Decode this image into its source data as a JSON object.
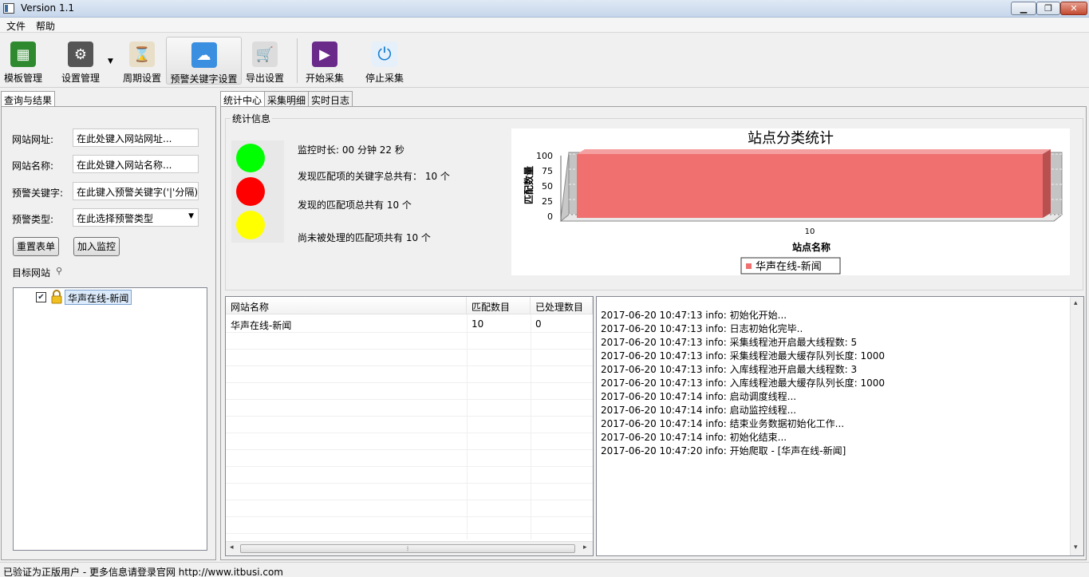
{
  "window": {
    "title": "Version 1.1"
  },
  "menu": {
    "items": [
      "文件",
      "帮助"
    ]
  },
  "toolbar": {
    "buttons": [
      {
        "label": "模板管理",
        "icon": "circuit-board-icon",
        "color": "#2f8a2f"
      },
      {
        "label": "设置管理",
        "icon": "gear-icon",
        "color": "#555555"
      },
      {
        "label": "周期设置",
        "icon": "hourglass-icon",
        "color": "#c8a050"
      },
      {
        "label": "预警关键字设置",
        "icon": "weather-alert-icon",
        "color": "#3a8fe0"
      },
      {
        "label": "导出设置",
        "icon": "cart-icon",
        "color": "#c0c0c0"
      },
      {
        "label": "开始采集",
        "icon": "play-icon",
        "color": "#6a2a8a"
      },
      {
        "label": "停止采集",
        "icon": "power-icon",
        "color": "#1a7fd0"
      }
    ]
  },
  "left_panel": {
    "tab": "查询与结果",
    "fields": {
      "url_label": "网站网址:",
      "url_value": "在此处键入网站网址...",
      "name_label": "网站名称:",
      "name_value": "在此处键入网站名称...",
      "keyword_label": "预警关键字:",
      "keyword_value": "在此键入预警关键字('|'分隔)",
      "type_label": "预警类型:",
      "type_value": "在此选择预警类型"
    },
    "reset_button": "重置表单",
    "add_button": "加入监控",
    "target_label": "目标网站",
    "tree_node": "华声在线-新闻"
  },
  "right_tabs": [
    "统计中心",
    "采集明细",
    "实时日志"
  ],
  "stats": {
    "group_title": "统计信息",
    "colors": {
      "green": "#00ff00",
      "red": "#ff0000",
      "yellow": "#ffff00"
    },
    "lines": [
      "监控时长: 00 分钟 22 秒",
      "发现匹配项的关键字总共有： 10 个",
      "发现的匹配项总共有 10 个",
      "尚未被处理的匹配项共有 10 个"
    ]
  },
  "chart_data": {
    "type": "bar",
    "title": "站点分类统计",
    "xlabel": "站点名称",
    "ylabel": "匹配数量",
    "categories": [
      "10"
    ],
    "series": [
      {
        "name": "华声在线-新闻",
        "values": [
          100
        ],
        "color": "#f07070"
      }
    ],
    "yticks": [
      0,
      25,
      50,
      75,
      100
    ],
    "ylim": [
      0,
      100
    ],
    "legend": "bottom"
  },
  "table": {
    "columns": [
      "网站名称",
      "匹配数目",
      "已处理数目"
    ],
    "rows": [
      [
        "华声在线-新闻",
        "10",
        "0"
      ]
    ]
  },
  "log": [
    "2017-06-20 10:47:13 info: 初始化开始...",
    "2017-06-20 10:47:13 info: 日志初始化完毕..",
    "2017-06-20 10:47:13 info: 采集线程池开启最大线程数: 5",
    "2017-06-20 10:47:13 info: 采集线程池最大缓存队列长度: 1000",
    "2017-06-20 10:47:13 info: 入库线程池开启最大线程数: 3",
    "2017-06-20 10:47:13 info: 入库线程池最大缓存队列长度: 1000",
    "2017-06-20 10:47:14 info: 启动调度线程...",
    "2017-06-20 10:47:14 info: 启动监控线程...",
    "2017-06-20 10:47:14 info: 结束业务数据初始化工作...",
    "2017-06-20 10:47:14 info: 初始化结束...",
    "2017-06-20 10:47:20 info: 开始爬取 - [华声在线-新闻]"
  ],
  "status": {
    "text": "已验证为正版用户 - 更多信息请登录官网 http://www.itbusi.com"
  }
}
